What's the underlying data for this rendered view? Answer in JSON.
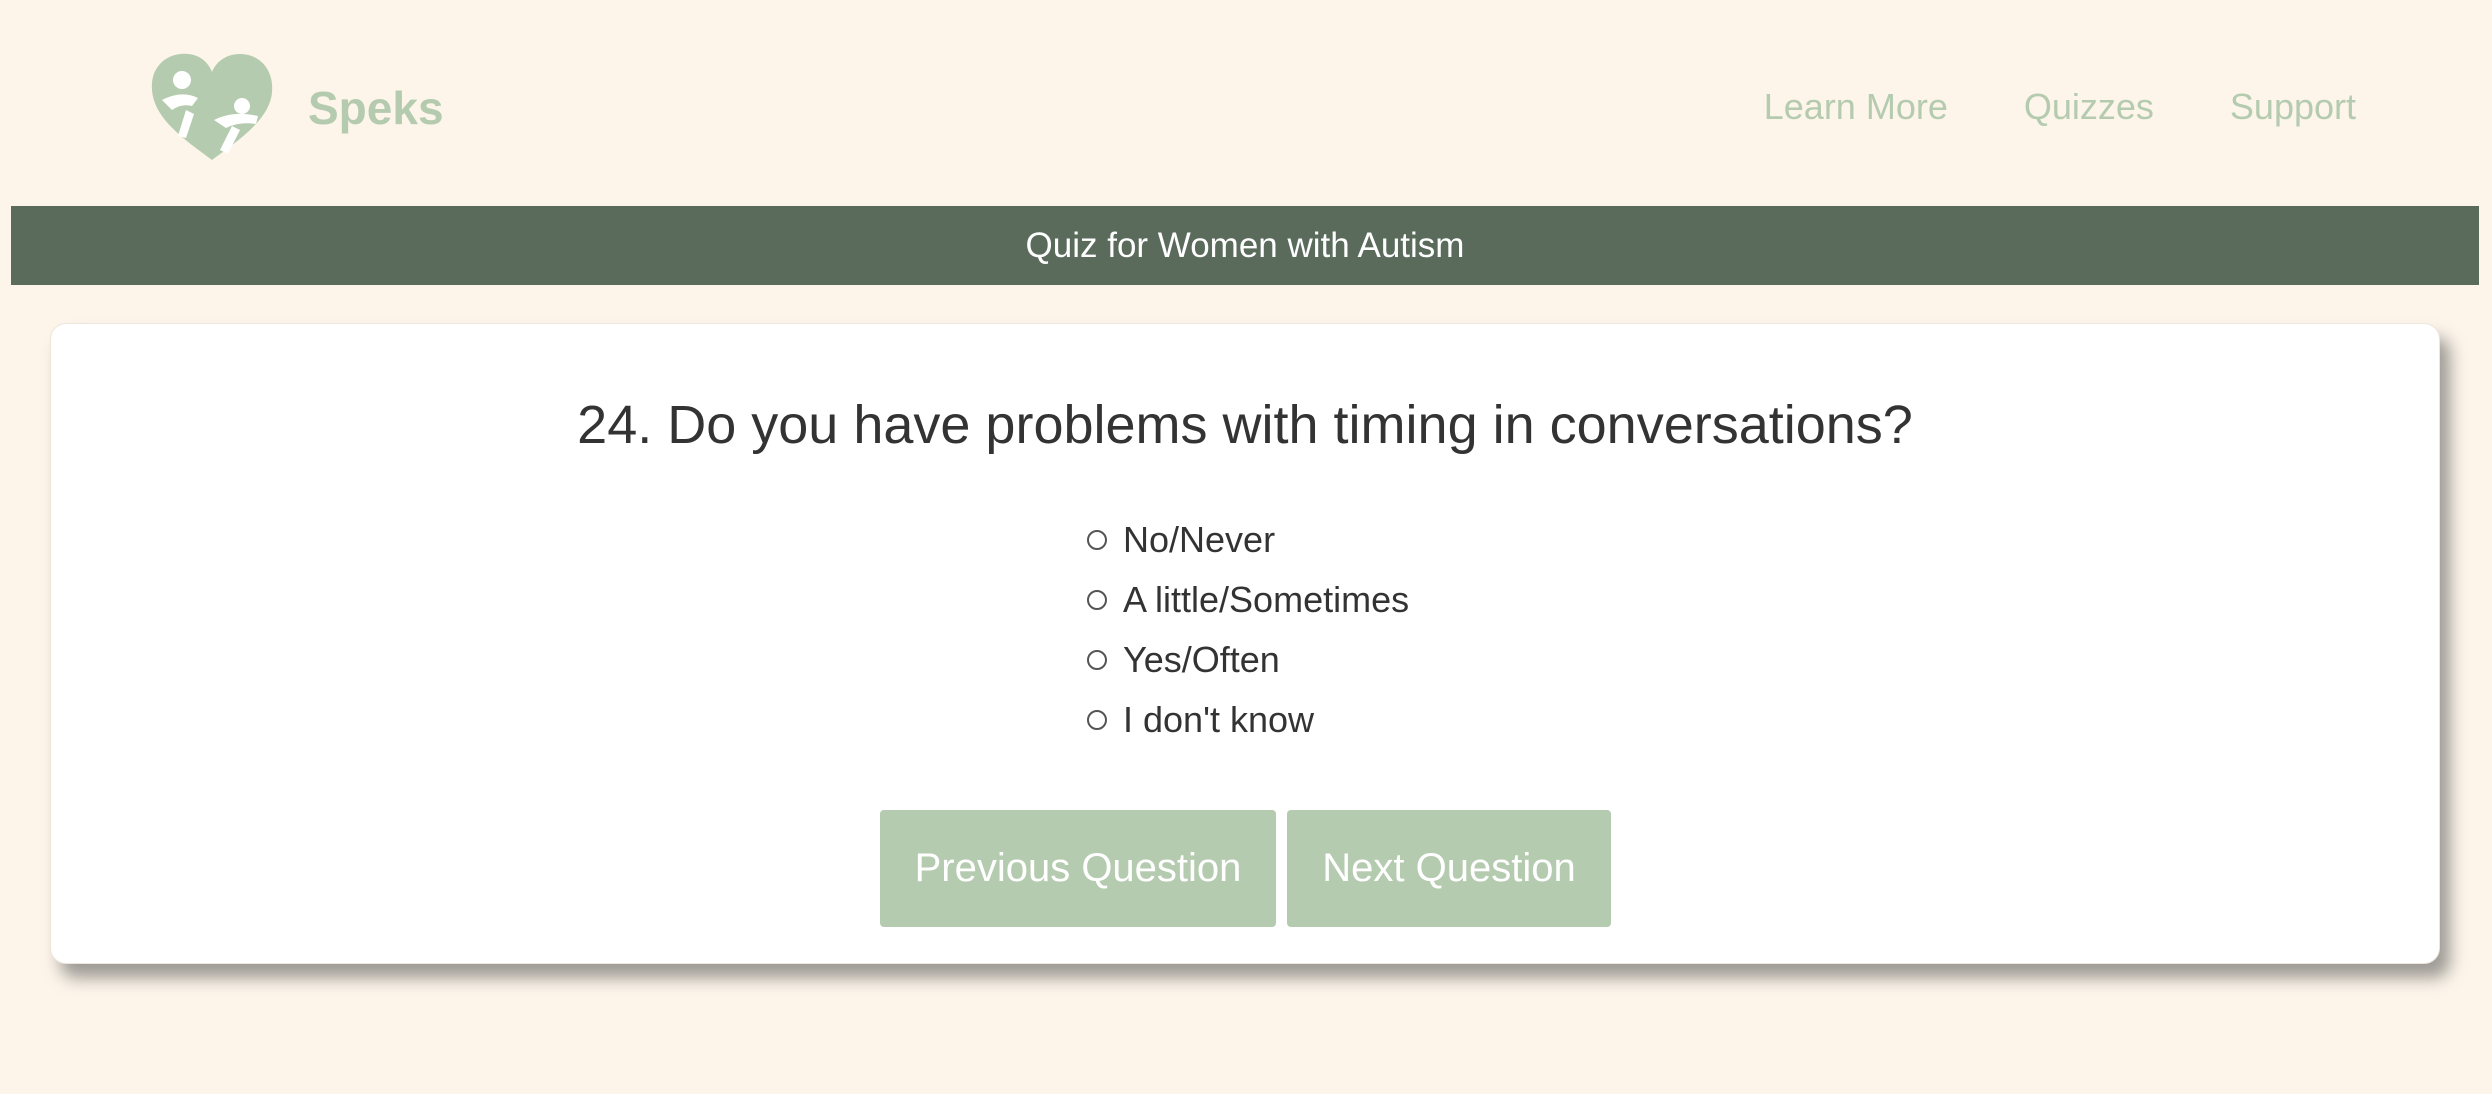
{
  "header": {
    "brand": "Speks",
    "logo_icon": "heart-family-icon",
    "nav": [
      "Learn More",
      "Quizzes",
      "Support"
    ]
  },
  "banner": {
    "title": "Quiz for Women with Autism"
  },
  "quiz": {
    "question": "24. Do you have problems with timing in conversations?",
    "options": [
      "No/Never",
      "A little/Sometimes",
      "Yes/Often",
      "I don't know"
    ],
    "selected": null,
    "prev_label": "Previous Question",
    "next_label": "Next Question"
  },
  "colors": {
    "background": "#fdf5ea",
    "accent": "#b5cbaf",
    "banner": "#5a6b5c",
    "text": "#333333"
  }
}
